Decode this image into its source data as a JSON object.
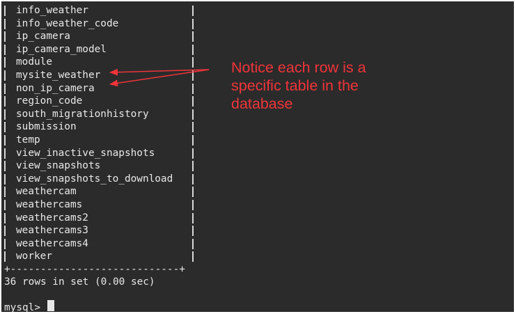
{
  "table_rows": [
    "info_weather",
    "info_weather_code",
    "ip_camera",
    "ip_camera_model",
    "module",
    "mysite_weather",
    "non_ip_camera",
    "region_code",
    "south_migrationhistory",
    "submission",
    "temp",
    "view_inactive_snapshots",
    "view_snapshots",
    "view_snapshots_to_download",
    "weathercam",
    "weathercams",
    "weathercams2",
    "weathercams3",
    "weathercams4",
    "worker"
  ],
  "table_border": "+----------------------------+",
  "result_summary": "36 rows in set (0.00 sec)",
  "prompt": "mysql> ",
  "annotation": {
    "text": "Notice each row is a specific table in the database",
    "color": "#f0343a"
  },
  "colors": {
    "terminal_background": "#2b2b2b",
    "terminal_text": "#e8e8e8",
    "annotation_arrow": "#f0343a"
  }
}
